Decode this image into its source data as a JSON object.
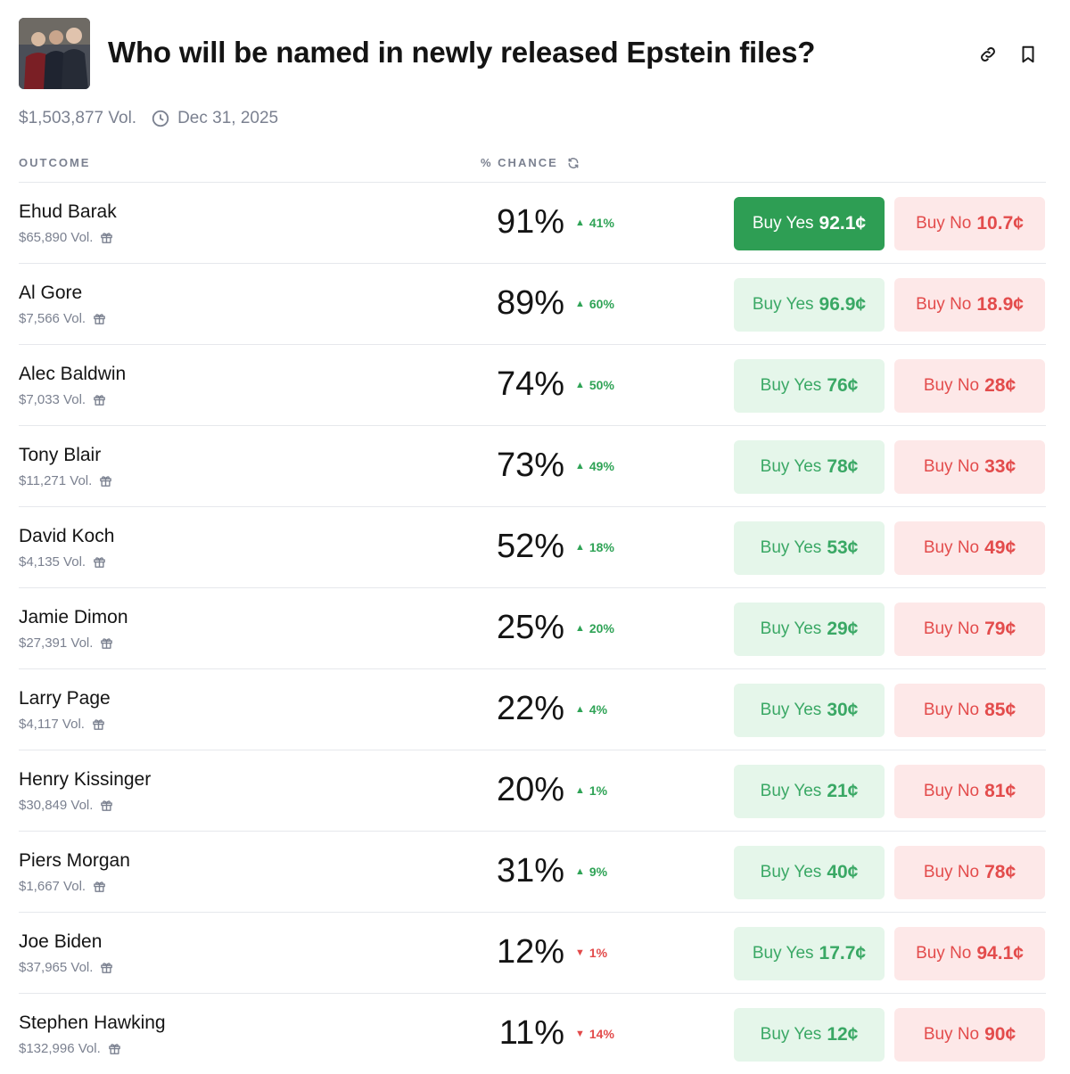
{
  "header": {
    "title": "Who will be named in newly released Epstein files?",
    "volume": "$1,503,877 Vol.",
    "end_date": "Dec 31, 2025"
  },
  "table": {
    "col_outcome": "OUTCOME",
    "col_chance": "% CHANCE"
  },
  "outcomes": [
    {
      "name": "Ehud Barak",
      "volume": "$65,890 Vol.",
      "chance": "91%",
      "delta": "41%",
      "direction": "up",
      "yes_label": "Buy Yes",
      "yes_price": "92.1¢",
      "no_label": "Buy No",
      "no_price": "10.7¢",
      "yes_active": true
    },
    {
      "name": "Al Gore",
      "volume": "$7,566 Vol.",
      "chance": "89%",
      "delta": "60%",
      "direction": "up",
      "yes_label": "Buy Yes",
      "yes_price": "96.9¢",
      "no_label": "Buy No",
      "no_price": "18.9¢"
    },
    {
      "name": "Alec Baldwin",
      "volume": "$7,033 Vol.",
      "chance": "74%",
      "delta": "50%",
      "direction": "up",
      "yes_label": "Buy Yes",
      "yes_price": "76¢",
      "no_label": "Buy No",
      "no_price": "28¢"
    },
    {
      "name": "Tony Blair",
      "volume": "$11,271 Vol.",
      "chance": "73%",
      "delta": "49%",
      "direction": "up",
      "yes_label": "Buy Yes",
      "yes_price": "78¢",
      "no_label": "Buy No",
      "no_price": "33¢"
    },
    {
      "name": "David Koch",
      "volume": "$4,135 Vol.",
      "chance": "52%",
      "delta": "18%",
      "direction": "up",
      "yes_label": "Buy Yes",
      "yes_price": "53¢",
      "no_label": "Buy No",
      "no_price": "49¢"
    },
    {
      "name": "Jamie Dimon",
      "volume": "$27,391 Vol.",
      "chance": "25%",
      "delta": "20%",
      "direction": "up",
      "yes_label": "Buy Yes",
      "yes_price": "29¢",
      "no_label": "Buy No",
      "no_price": "79¢"
    },
    {
      "name": "Larry Page",
      "volume": "$4,117 Vol.",
      "chance": "22%",
      "delta": "4%",
      "direction": "up",
      "yes_label": "Buy Yes",
      "yes_price": "30¢",
      "no_label": "Buy No",
      "no_price": "85¢"
    },
    {
      "name": "Henry Kissinger",
      "volume": "$30,849 Vol.",
      "chance": "20%",
      "delta": "1%",
      "direction": "up",
      "yes_label": "Buy Yes",
      "yes_price": "21¢",
      "no_label": "Buy No",
      "no_price": "81¢"
    },
    {
      "name": "Piers Morgan",
      "volume": "$1,667 Vol.",
      "chance": "31%",
      "delta": "9%",
      "direction": "up",
      "yes_label": "Buy Yes",
      "yes_price": "40¢",
      "no_label": "Buy No",
      "no_price": "78¢"
    },
    {
      "name": "Joe Biden",
      "volume": "$37,965 Vol.",
      "chance": "12%",
      "delta": "1%",
      "direction": "down",
      "yes_label": "Buy Yes",
      "yes_price": "17.7¢",
      "no_label": "Buy No",
      "no_price": "94.1¢"
    },
    {
      "name": "Stephen Hawking",
      "volume": "$132,996 Vol.",
      "chance": "11%",
      "delta": "14%",
      "direction": "down",
      "yes_label": "Buy Yes",
      "yes_price": "12¢",
      "no_label": "Buy No",
      "no_price": "90¢"
    }
  ],
  "colors": {
    "yes": "#2e9e54",
    "yes_bg": "#e5f6ea",
    "no": "#e34c4c",
    "no_bg": "#fde8e8"
  },
  "icons": {
    "link": "link-icon",
    "bookmark": "bookmark-icon",
    "clock": "clock-icon",
    "refresh": "refresh-icon",
    "gift": "gift-icon"
  }
}
